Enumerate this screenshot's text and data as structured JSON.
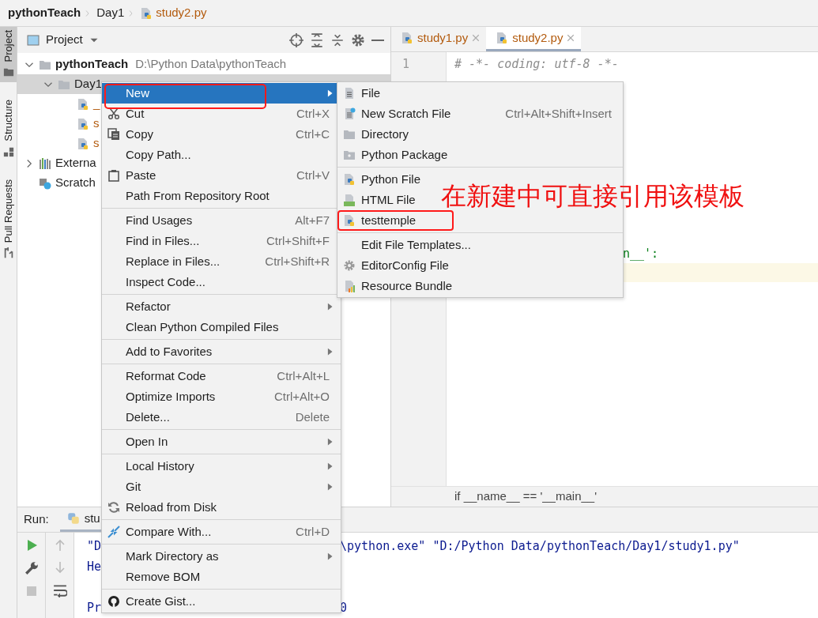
{
  "breadcrumb": [
    {
      "label": "pythonTeach",
      "kind": "project"
    },
    {
      "label": "Day1",
      "kind": "folder"
    },
    {
      "label": "study2.py",
      "kind": "file"
    }
  ],
  "tool_stripe": [
    {
      "label": "Project",
      "kind": "project",
      "selected": true
    },
    {
      "label": "Structure",
      "kind": "structure",
      "selected": false
    },
    {
      "label": "Pull Requests",
      "kind": "pull",
      "selected": false
    }
  ],
  "project_panel": {
    "title": "Project",
    "tree": [
      {
        "label": "pythonTeach",
        "path": "D:\\Python Data\\pythonTeach",
        "kind": "project",
        "expanded": true,
        "selected": false,
        "children": [
          {
            "label": "Day1",
            "kind": "folder",
            "expanded": true,
            "selected": true,
            "children": [
              {
                "label": "_",
                "kind": "python",
                "selected": false
              },
              {
                "label": "s",
                "kind": "python",
                "selected": false
              },
              {
                "label": "s",
                "kind": "python",
                "selected": false
              }
            ]
          }
        ]
      },
      {
        "label": "Externa",
        "kind": "libraries",
        "expanded": false,
        "selected": false
      },
      {
        "label": "Scratch",
        "kind": "scratch",
        "selected": false
      }
    ]
  },
  "editor": {
    "tabs": [
      {
        "label": "study1.py",
        "selected": false
      },
      {
        "label": "study2.py",
        "selected": true
      }
    ],
    "line_numbers": [
      "1"
    ],
    "lines": [
      "# -*- coding: utf-8 -*-"
    ],
    "fragment": "n__':",
    "breadcrumb": "if __name__ == '__main__'"
  },
  "run_panel": {
    "label": "Run:",
    "tab": {
      "label": "stu",
      "selected": true
    },
    "console": [
      {
        "start": "\"D",
        "end": "\\python.exe\" \"D:/Python Data/pythonTeach/Day1/study1.py\""
      },
      {
        "start": "He"
      },
      {
        "start": "Pr",
        "end": "0",
        "blank_before": true
      }
    ]
  },
  "context_menu": {
    "groups": [
      [
        {
          "label": "New",
          "kind": "plain",
          "selected": true,
          "has_submenu": true,
          "annotated": true
        },
        {
          "label": "Cut",
          "kind": "cut",
          "shortcut": "Ctrl+X",
          "selected": false
        },
        {
          "label": "Copy",
          "kind": "copy",
          "shortcut": "Ctrl+C",
          "selected": false
        },
        {
          "label": "Copy Path...",
          "kind": "plain",
          "selected": false
        },
        {
          "label": "Paste",
          "kind": "paste",
          "shortcut": "Ctrl+V",
          "selected": false
        },
        {
          "label": "Path From Repository Root",
          "kind": "plain",
          "selected": false
        }
      ],
      [
        {
          "label": "Find Usages",
          "kind": "plain",
          "shortcut": "Alt+F7",
          "selected": false
        },
        {
          "label": "Find in Files...",
          "kind": "plain",
          "shortcut": "Ctrl+Shift+F",
          "selected": false
        },
        {
          "label": "Replace in Files...",
          "kind": "plain",
          "shortcut": "Ctrl+Shift+R",
          "selected": false
        },
        {
          "label": "Inspect Code...",
          "kind": "plain",
          "selected": false
        }
      ],
      [
        {
          "label": "Refactor",
          "kind": "plain",
          "selected": false,
          "has_submenu": true
        },
        {
          "label": "Clean Python Compiled Files",
          "kind": "plain",
          "selected": false
        }
      ],
      [
        {
          "label": "Add to Favorites",
          "kind": "plain",
          "selected": false,
          "has_submenu": true
        }
      ],
      [
        {
          "label": "Reformat Code",
          "kind": "plain",
          "shortcut": "Ctrl+Alt+L",
          "selected": false
        },
        {
          "label": "Optimize Imports",
          "kind": "plain",
          "shortcut": "Ctrl+Alt+O",
          "selected": false
        },
        {
          "label": "Delete...",
          "kind": "plain",
          "shortcut": "Delete",
          "selected": false
        }
      ],
      [
        {
          "label": "Open In",
          "kind": "plain",
          "selected": false,
          "has_submenu": true
        }
      ],
      [
        {
          "label": "Local History",
          "kind": "plain",
          "selected": false,
          "has_submenu": true
        },
        {
          "label": "Git",
          "kind": "plain",
          "selected": false,
          "has_submenu": true
        },
        {
          "label": "Reload from Disk",
          "kind": "reload",
          "selected": false
        }
      ],
      [
        {
          "label": "Compare With...",
          "kind": "compare",
          "shortcut": "Ctrl+D",
          "selected": false
        }
      ],
      [
        {
          "label": "Mark Directory as",
          "kind": "plain",
          "selected": false,
          "has_submenu": true
        },
        {
          "label": "Remove BOM",
          "kind": "plain",
          "selected": false
        }
      ],
      [
        {
          "label": "Create Gist...",
          "kind": "gist",
          "selected": false
        }
      ]
    ]
  },
  "new_submenu": {
    "groups": [
      [
        {
          "label": "File",
          "kind": "file"
        },
        {
          "label": "New Scratch File",
          "kind": "scratch",
          "shortcut": "Ctrl+Alt+Shift+Insert"
        },
        {
          "label": "Directory",
          "kind": "folder"
        },
        {
          "label": "Python Package",
          "kind": "package"
        }
      ],
      [
        {
          "label": "Python File",
          "kind": "python"
        },
        {
          "label": "HTML File",
          "kind": "html"
        },
        {
          "label": "testtemple",
          "kind": "python",
          "annotated": true
        }
      ],
      [
        {
          "label": "Edit File Templates...",
          "kind": "plain"
        },
        {
          "label": "EditorConfig File",
          "kind": "gear"
        },
        {
          "label": "Resource Bundle",
          "kind": "resource"
        }
      ]
    ]
  },
  "annotation": {
    "text": "在新建中可直接引用该模板"
  }
}
